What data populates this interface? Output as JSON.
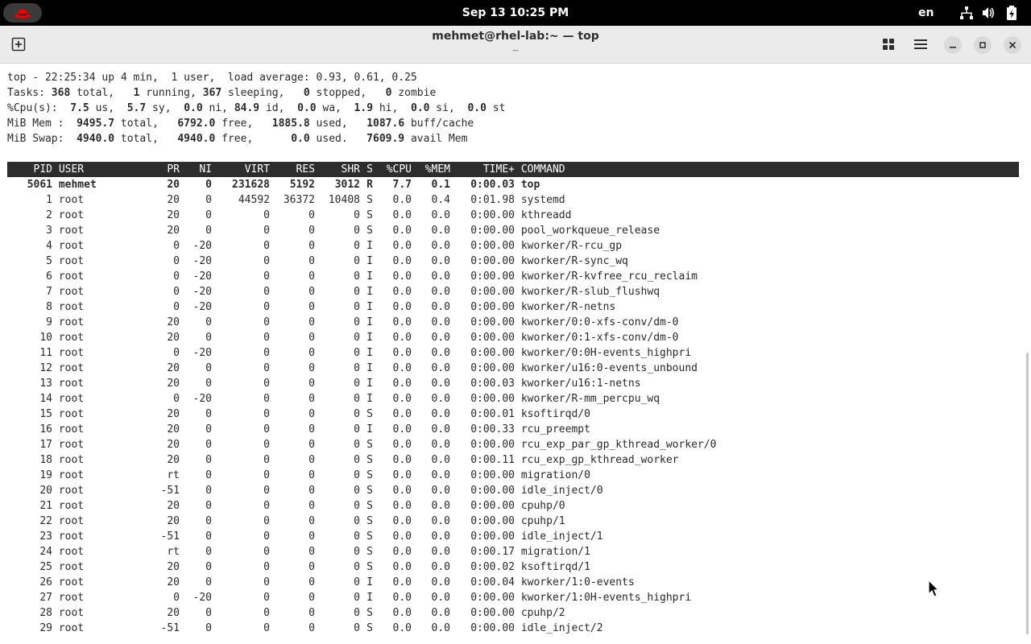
{
  "topbar": {
    "clock": "Sep 13  10:25 PM",
    "language": "en",
    "icons": [
      "redhat-logo-icon",
      "network-icon",
      "volume-icon",
      "battery-icon"
    ]
  },
  "window": {
    "title": "mehmet@rhel-lab:~ — top",
    "subtitle": "~",
    "icons": [
      "new-tab-icon",
      "tab-overview-icon",
      "hamburger-menu-icon",
      "minimize-icon",
      "maximize-icon",
      "close-icon"
    ]
  },
  "summary": {
    "l1": {
      "text": "top - 22:25:34 up 4 min,  1 user,  load average: 0.93, 0.61, 0.25"
    },
    "l2": {
      "a": "Tasks: ",
      "v1": "368",
      "b": " total,   ",
      "v2": "1",
      "c": " running, ",
      "v3": "367",
      "d": " sleeping,   ",
      "v4": "0",
      "e": " stopped,   ",
      "v5": "0",
      "f": " zombie"
    },
    "l3": {
      "a": "%Cpu(s):  ",
      "v1": "7.5",
      "b": " us,  ",
      "v2": "5.7",
      "c": " sy,  ",
      "v3": "0.0",
      "d": " ni, ",
      "v4": "84.9",
      "e": " id,  ",
      "v5": "0.0",
      "f": " wa,  ",
      "v6": "1.9",
      "g": " hi,  ",
      "v7": "0.0",
      "h": " si,  ",
      "v8": "0.0",
      "i": " st"
    },
    "l4": {
      "a": "MiB Mem :  ",
      "v1": "9495.7",
      "b": " total,   ",
      "v2": "6792.0",
      "c": " free,   ",
      "v3": "1885.8",
      "d": " used,   ",
      "v4": "1087.6",
      "e": " buff/cache"
    },
    "l5": {
      "a": "MiB Swap:  ",
      "v1": "4940.0",
      "b": " total,   ",
      "v2": "4940.0",
      "c": " free,      ",
      "v3": "0.0",
      "d": " used.   ",
      "v4": "7609.9",
      "e": " avail Mem"
    }
  },
  "columns": {
    "pid": "PID",
    "user": "USER",
    "pr": "PR",
    "ni": "NI",
    "virt": "VIRT",
    "res": "RES",
    "shr": "SHR",
    "s": "S",
    "cpu": "%CPU",
    "mem": "%MEM",
    "time": "TIME+",
    "cmd": "COMMAND"
  },
  "processes": [
    {
      "pid": "5061",
      "user": "mehmet",
      "pr": "20",
      "ni": "0",
      "virt": "231628",
      "res": "5192",
      "shr": "3012",
      "s": "R",
      "cpu": "7.7",
      "mem": "0.1",
      "time": "0:00.03",
      "cmd": "top"
    },
    {
      "pid": "1",
      "user": "root",
      "pr": "20",
      "ni": "0",
      "virt": "44592",
      "res": "36372",
      "shr": "10408",
      "s": "S",
      "cpu": "0.0",
      "mem": "0.4",
      "time": "0:01.98",
      "cmd": "systemd"
    },
    {
      "pid": "2",
      "user": "root",
      "pr": "20",
      "ni": "0",
      "virt": "0",
      "res": "0",
      "shr": "0",
      "s": "S",
      "cpu": "0.0",
      "mem": "0.0",
      "time": "0:00.00",
      "cmd": "kthreadd"
    },
    {
      "pid": "3",
      "user": "root",
      "pr": "20",
      "ni": "0",
      "virt": "0",
      "res": "0",
      "shr": "0",
      "s": "S",
      "cpu": "0.0",
      "mem": "0.0",
      "time": "0:00.00",
      "cmd": "pool_workqueue_release"
    },
    {
      "pid": "4",
      "user": "root",
      "pr": "0",
      "ni": "-20",
      "virt": "0",
      "res": "0",
      "shr": "0",
      "s": "I",
      "cpu": "0.0",
      "mem": "0.0",
      "time": "0:00.00",
      "cmd": "kworker/R-rcu_gp"
    },
    {
      "pid": "5",
      "user": "root",
      "pr": "0",
      "ni": "-20",
      "virt": "0",
      "res": "0",
      "shr": "0",
      "s": "I",
      "cpu": "0.0",
      "mem": "0.0",
      "time": "0:00.00",
      "cmd": "kworker/R-sync_wq"
    },
    {
      "pid": "6",
      "user": "root",
      "pr": "0",
      "ni": "-20",
      "virt": "0",
      "res": "0",
      "shr": "0",
      "s": "I",
      "cpu": "0.0",
      "mem": "0.0",
      "time": "0:00.00",
      "cmd": "kworker/R-kvfree_rcu_reclaim"
    },
    {
      "pid": "7",
      "user": "root",
      "pr": "0",
      "ni": "-20",
      "virt": "0",
      "res": "0",
      "shr": "0",
      "s": "I",
      "cpu": "0.0",
      "mem": "0.0",
      "time": "0:00.00",
      "cmd": "kworker/R-slub_flushwq"
    },
    {
      "pid": "8",
      "user": "root",
      "pr": "0",
      "ni": "-20",
      "virt": "0",
      "res": "0",
      "shr": "0",
      "s": "I",
      "cpu": "0.0",
      "mem": "0.0",
      "time": "0:00.00",
      "cmd": "kworker/R-netns"
    },
    {
      "pid": "9",
      "user": "root",
      "pr": "20",
      "ni": "0",
      "virt": "0",
      "res": "0",
      "shr": "0",
      "s": "I",
      "cpu": "0.0",
      "mem": "0.0",
      "time": "0:00.00",
      "cmd": "kworker/0:0-xfs-conv/dm-0"
    },
    {
      "pid": "10",
      "user": "root",
      "pr": "20",
      "ni": "0",
      "virt": "0",
      "res": "0",
      "shr": "0",
      "s": "I",
      "cpu": "0.0",
      "mem": "0.0",
      "time": "0:00.00",
      "cmd": "kworker/0:1-xfs-conv/dm-0"
    },
    {
      "pid": "11",
      "user": "root",
      "pr": "0",
      "ni": "-20",
      "virt": "0",
      "res": "0",
      "shr": "0",
      "s": "I",
      "cpu": "0.0",
      "mem": "0.0",
      "time": "0:00.00",
      "cmd": "kworker/0:0H-events_highpri"
    },
    {
      "pid": "12",
      "user": "root",
      "pr": "20",
      "ni": "0",
      "virt": "0",
      "res": "0",
      "shr": "0",
      "s": "I",
      "cpu": "0.0",
      "mem": "0.0",
      "time": "0:00.00",
      "cmd": "kworker/u16:0-events_unbound"
    },
    {
      "pid": "13",
      "user": "root",
      "pr": "20",
      "ni": "0",
      "virt": "0",
      "res": "0",
      "shr": "0",
      "s": "I",
      "cpu": "0.0",
      "mem": "0.0",
      "time": "0:00.03",
      "cmd": "kworker/u16:1-netns"
    },
    {
      "pid": "14",
      "user": "root",
      "pr": "0",
      "ni": "-20",
      "virt": "0",
      "res": "0",
      "shr": "0",
      "s": "I",
      "cpu": "0.0",
      "mem": "0.0",
      "time": "0:00.00",
      "cmd": "kworker/R-mm_percpu_wq"
    },
    {
      "pid": "15",
      "user": "root",
      "pr": "20",
      "ni": "0",
      "virt": "0",
      "res": "0",
      "shr": "0",
      "s": "S",
      "cpu": "0.0",
      "mem": "0.0",
      "time": "0:00.01",
      "cmd": "ksoftirqd/0"
    },
    {
      "pid": "16",
      "user": "root",
      "pr": "20",
      "ni": "0",
      "virt": "0",
      "res": "0",
      "shr": "0",
      "s": "I",
      "cpu": "0.0",
      "mem": "0.0",
      "time": "0:00.33",
      "cmd": "rcu_preempt"
    },
    {
      "pid": "17",
      "user": "root",
      "pr": "20",
      "ni": "0",
      "virt": "0",
      "res": "0",
      "shr": "0",
      "s": "S",
      "cpu": "0.0",
      "mem": "0.0",
      "time": "0:00.00",
      "cmd": "rcu_exp_par_gp_kthread_worker/0"
    },
    {
      "pid": "18",
      "user": "root",
      "pr": "20",
      "ni": "0",
      "virt": "0",
      "res": "0",
      "shr": "0",
      "s": "S",
      "cpu": "0.0",
      "mem": "0.0",
      "time": "0:00.11",
      "cmd": "rcu_exp_gp_kthread_worker"
    },
    {
      "pid": "19",
      "user": "root",
      "pr": "rt",
      "ni": "0",
      "virt": "0",
      "res": "0",
      "shr": "0",
      "s": "S",
      "cpu": "0.0",
      "mem": "0.0",
      "time": "0:00.00",
      "cmd": "migration/0"
    },
    {
      "pid": "20",
      "user": "root",
      "pr": "-51",
      "ni": "0",
      "virt": "0",
      "res": "0",
      "shr": "0",
      "s": "S",
      "cpu": "0.0",
      "mem": "0.0",
      "time": "0:00.00",
      "cmd": "idle_inject/0"
    },
    {
      "pid": "21",
      "user": "root",
      "pr": "20",
      "ni": "0",
      "virt": "0",
      "res": "0",
      "shr": "0",
      "s": "S",
      "cpu": "0.0",
      "mem": "0.0",
      "time": "0:00.00",
      "cmd": "cpuhp/0"
    },
    {
      "pid": "22",
      "user": "root",
      "pr": "20",
      "ni": "0",
      "virt": "0",
      "res": "0",
      "shr": "0",
      "s": "S",
      "cpu": "0.0",
      "mem": "0.0",
      "time": "0:00.00",
      "cmd": "cpuhp/1"
    },
    {
      "pid": "23",
      "user": "root",
      "pr": "-51",
      "ni": "0",
      "virt": "0",
      "res": "0",
      "shr": "0",
      "s": "S",
      "cpu": "0.0",
      "mem": "0.0",
      "time": "0:00.00",
      "cmd": "idle_inject/1"
    },
    {
      "pid": "24",
      "user": "root",
      "pr": "rt",
      "ni": "0",
      "virt": "0",
      "res": "0",
      "shr": "0",
      "s": "S",
      "cpu": "0.0",
      "mem": "0.0",
      "time": "0:00.17",
      "cmd": "migration/1"
    },
    {
      "pid": "25",
      "user": "root",
      "pr": "20",
      "ni": "0",
      "virt": "0",
      "res": "0",
      "shr": "0",
      "s": "S",
      "cpu": "0.0",
      "mem": "0.0",
      "time": "0:00.02",
      "cmd": "ksoftirqd/1"
    },
    {
      "pid": "26",
      "user": "root",
      "pr": "20",
      "ni": "0",
      "virt": "0",
      "res": "0",
      "shr": "0",
      "s": "I",
      "cpu": "0.0",
      "mem": "0.0",
      "time": "0:00.04",
      "cmd": "kworker/1:0-events"
    },
    {
      "pid": "27",
      "user": "root",
      "pr": "0",
      "ni": "-20",
      "virt": "0",
      "res": "0",
      "shr": "0",
      "s": "I",
      "cpu": "0.0",
      "mem": "0.0",
      "time": "0:00.00",
      "cmd": "kworker/1:0H-events_highpri"
    },
    {
      "pid": "28",
      "user": "root",
      "pr": "20",
      "ni": "0",
      "virt": "0",
      "res": "0",
      "shr": "0",
      "s": "S",
      "cpu": "0.0",
      "mem": "0.0",
      "time": "0:00.00",
      "cmd": "cpuhp/2"
    },
    {
      "pid": "29",
      "user": "root",
      "pr": "-51",
      "ni": "0",
      "virt": "0",
      "res": "0",
      "shr": "0",
      "s": "S",
      "cpu": "0.0",
      "mem": "0.0",
      "time": "0:00.00",
      "cmd": "idle_inject/2"
    }
  ],
  "colors": {
    "topbar": "#000000",
    "headerbar": "#ebebeb",
    "terminal_bg": "#ffffff",
    "terminal_fg": "#2a2a2a",
    "table_header_bg": "#2d2d2d",
    "table_header_fg": "#ffffff",
    "redhat": "#ee0000"
  }
}
